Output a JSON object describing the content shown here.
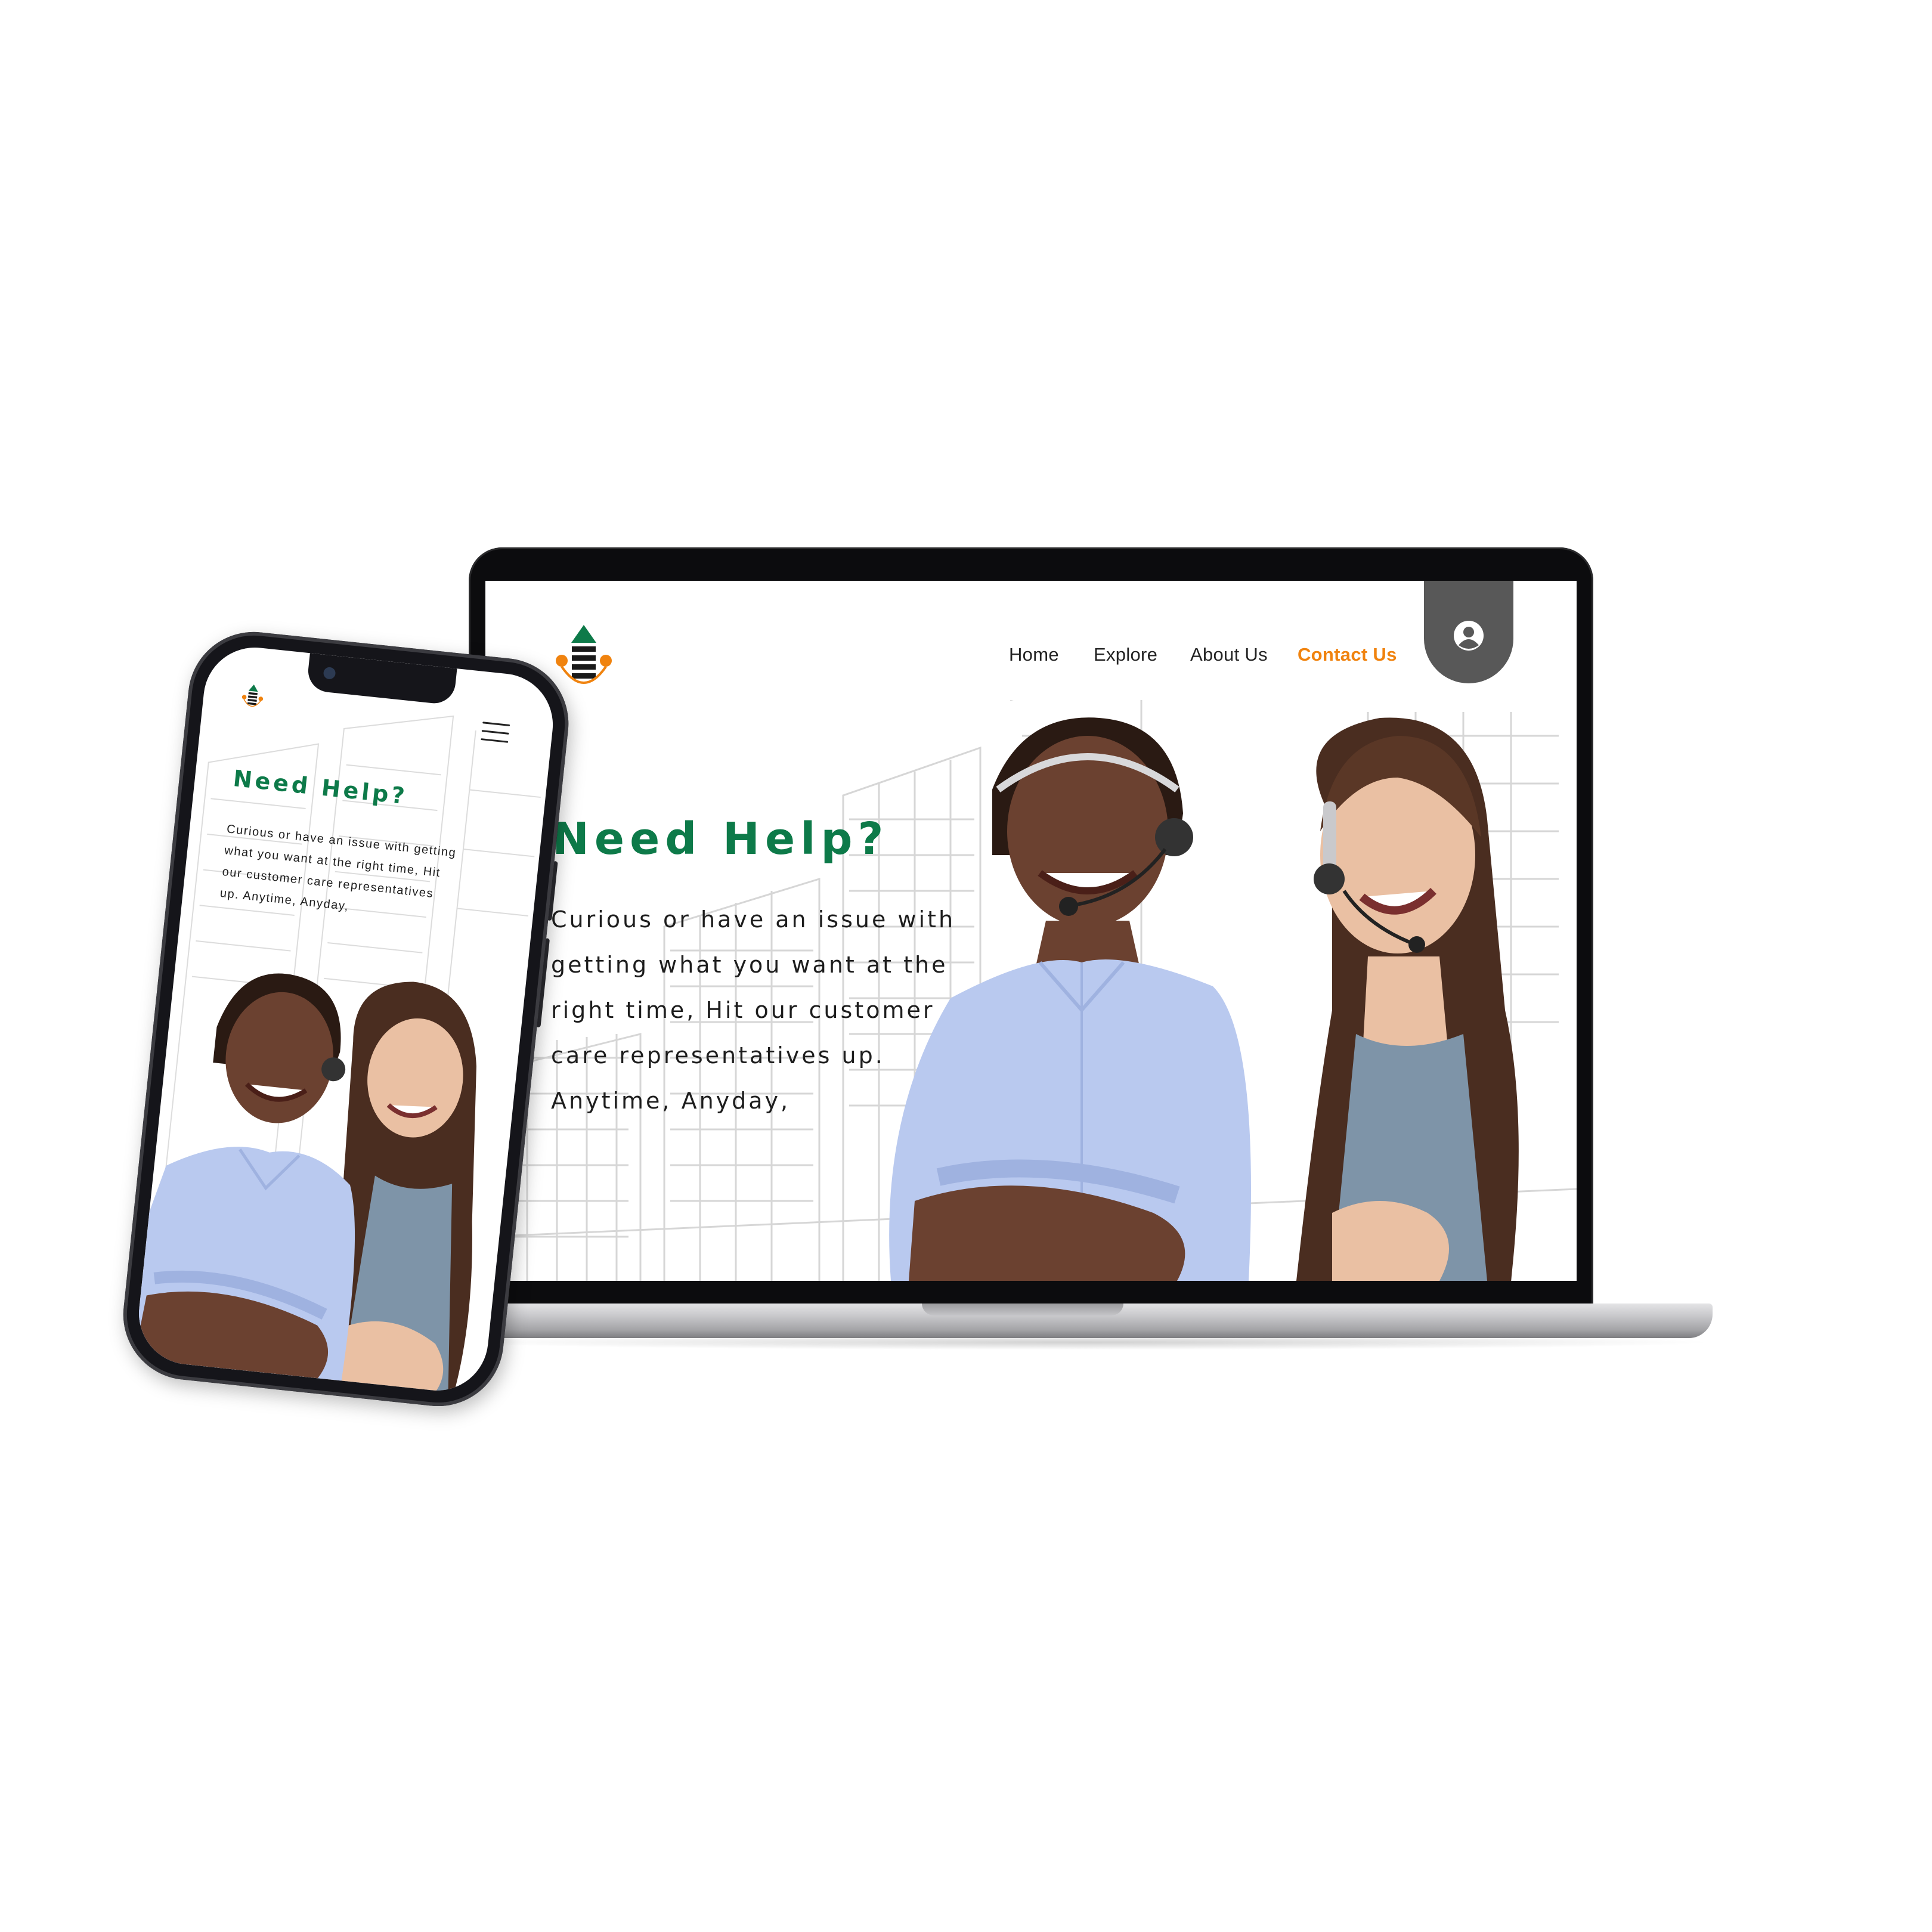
{
  "desktop": {
    "nav": {
      "items": [
        {
          "label": "Home"
        },
        {
          "label": "Explore"
        },
        {
          "label": "About Us"
        },
        {
          "label": "Contact Us",
          "active": true
        }
      ]
    },
    "hero": {
      "title": "Need Help?",
      "body_lines": [
        "Curious or have an issue with",
        "getting what you want at the",
        "right time, Hit our customer",
        "care representatives up.",
        "Anytime, Anyday,"
      ]
    },
    "icons": {
      "account": "user-circle-icon",
      "logo": "brand-logo"
    }
  },
  "mobile": {
    "hero": {
      "title": "Need Help?",
      "body_lines": [
        "Curious or have an issue with getting",
        "what you want at the right time, Hit",
        "our customer care representatives",
        "up. Anytime, Anyday,"
      ]
    },
    "icons": {
      "menu": "hamburger-menu-icon"
    }
  },
  "colors": {
    "brand_green": "#0d7a49",
    "accent_orange": "#f0830f",
    "user_tab": "#585858",
    "shirt_blue": "#b9c9ef"
  }
}
